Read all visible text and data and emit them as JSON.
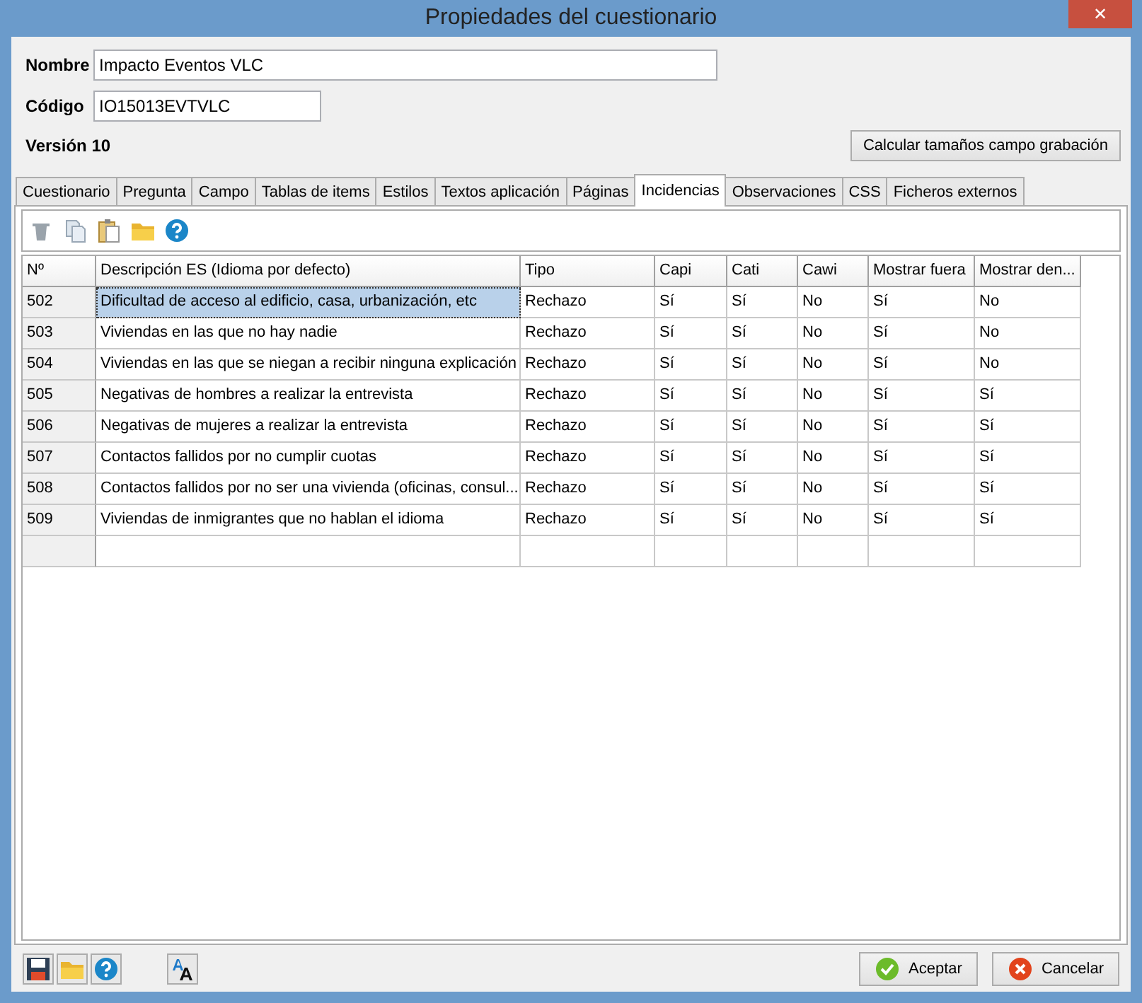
{
  "window": {
    "title": "Propiedades del cuestionario",
    "close": "✕"
  },
  "form": {
    "nombre_label": "Nombre",
    "nombre": "Impacto Eventos VLC",
    "codigo_label": "Código",
    "codigo": "IO15013EVTVLC",
    "version": "Versión 10",
    "calc_button": "Calcular tamaños campo grabación"
  },
  "tabs": [
    {
      "label": "Cuestionario",
      "selected": false
    },
    {
      "label": "Pregunta",
      "selected": false
    },
    {
      "label": "Campo",
      "selected": false
    },
    {
      "label": "Tablas de items",
      "selected": false
    },
    {
      "label": "Estilos",
      "selected": false
    },
    {
      "label": "Textos aplicación",
      "selected": false
    },
    {
      "label": "Páginas",
      "selected": false
    },
    {
      "label": "Incidencias",
      "selected": true
    },
    {
      "label": "Observaciones",
      "selected": false
    },
    {
      "label": "CSS",
      "selected": false
    },
    {
      "label": "Ficheros externos",
      "selected": false
    }
  ],
  "table": {
    "columns": [
      "Nº",
      "Descripción ES (Idioma por defecto)",
      "Tipo",
      "Capi",
      "Cati",
      "Cawi",
      "Mostrar fuera",
      "Mostrar den..."
    ],
    "rows": [
      {
        "selected": true,
        "cells": [
          "502",
          "Dificultad de acceso al edificio, casa, urbanización, etc",
          "Rechazo",
          "Sí",
          "Sí",
          "No",
          "Sí",
          "No"
        ]
      },
      {
        "selected": false,
        "cells": [
          "503",
          "Viviendas en las que no hay nadie",
          "Rechazo",
          "Sí",
          "Sí",
          "No",
          "Sí",
          "No"
        ]
      },
      {
        "selected": false,
        "cells": [
          "504",
          "Viviendas en las que se niegan a recibir ninguna explicación",
          "Rechazo",
          "Sí",
          "Sí",
          "No",
          "Sí",
          "No"
        ]
      },
      {
        "selected": false,
        "cells": [
          "505",
          "Negativas de hombres a realizar la entrevista",
          "Rechazo",
          "Sí",
          "Sí",
          "No",
          "Sí",
          "Sí"
        ]
      },
      {
        "selected": false,
        "cells": [
          "506",
          "Negativas de mujeres a realizar la entrevista",
          "Rechazo",
          "Sí",
          "Sí",
          "No",
          "Sí",
          "Sí"
        ]
      },
      {
        "selected": false,
        "cells": [
          "507",
          "Contactos fallidos por no cumplir cuotas",
          "Rechazo",
          "Sí",
          "Sí",
          "No",
          "Sí",
          "Sí"
        ]
      },
      {
        "selected": false,
        "cells": [
          "508",
          "Contactos fallidos por no ser una vivienda (oficinas, consul...",
          "Rechazo",
          "Sí",
          "Sí",
          "No",
          "Sí",
          "Sí"
        ]
      },
      {
        "selected": false,
        "cells": [
          "509",
          "Viviendas de inmigrantes que no hablan el idioma",
          "Rechazo",
          "Sí",
          "Sí",
          "No",
          "Sí",
          "Sí"
        ]
      }
    ]
  },
  "buttons": {
    "accept": "Aceptar",
    "cancel": "Cancelar"
  }
}
